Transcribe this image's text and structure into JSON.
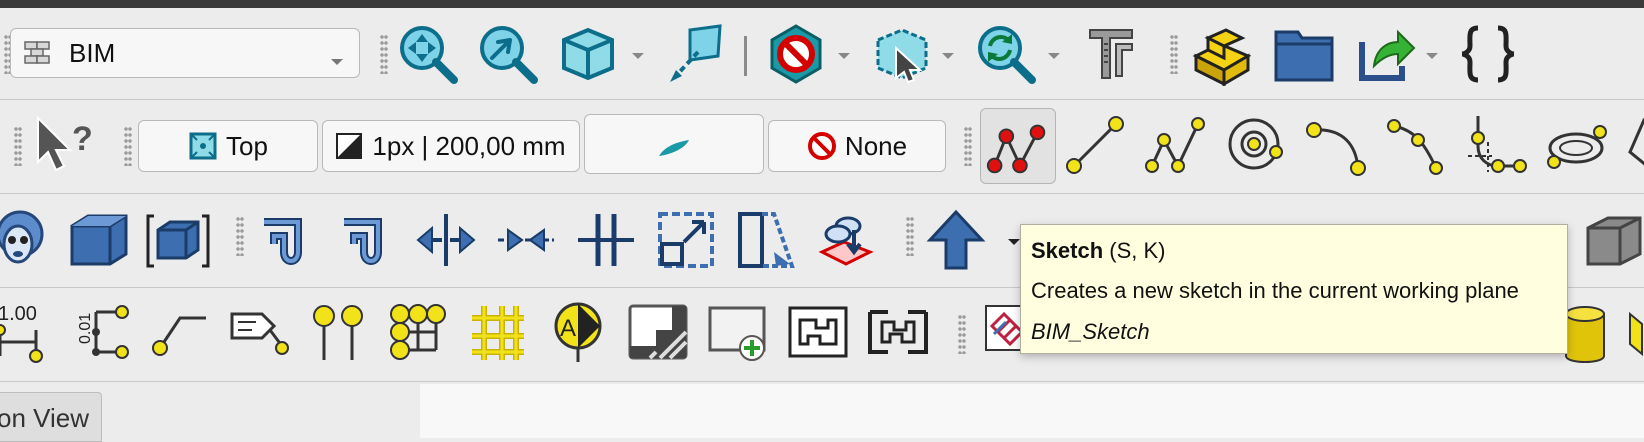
{
  "workbench": {
    "name": "BIM",
    "icon": "bricks-icon"
  },
  "row2": {
    "view_label": "Top",
    "line_width": "1px | 200,00 mm",
    "style_label": "None"
  },
  "tooltip": {
    "title": "Sketch",
    "shortcut": "(S, K)",
    "description": "Creates a new sketch in the current working plane",
    "command": "BIM_Sketch"
  },
  "row4": {
    "label_100": "1.00",
    "label_010": "0.01"
  },
  "bottom_tab": {
    "label": "on View"
  },
  "colors": {
    "tooltip_bg": "#ffffe0",
    "toolbar_bg": "#ececec",
    "icon_blue": "#3d6fb0",
    "icon_teal": "#1a9aa6",
    "icon_yellow": "#f2e21a"
  }
}
